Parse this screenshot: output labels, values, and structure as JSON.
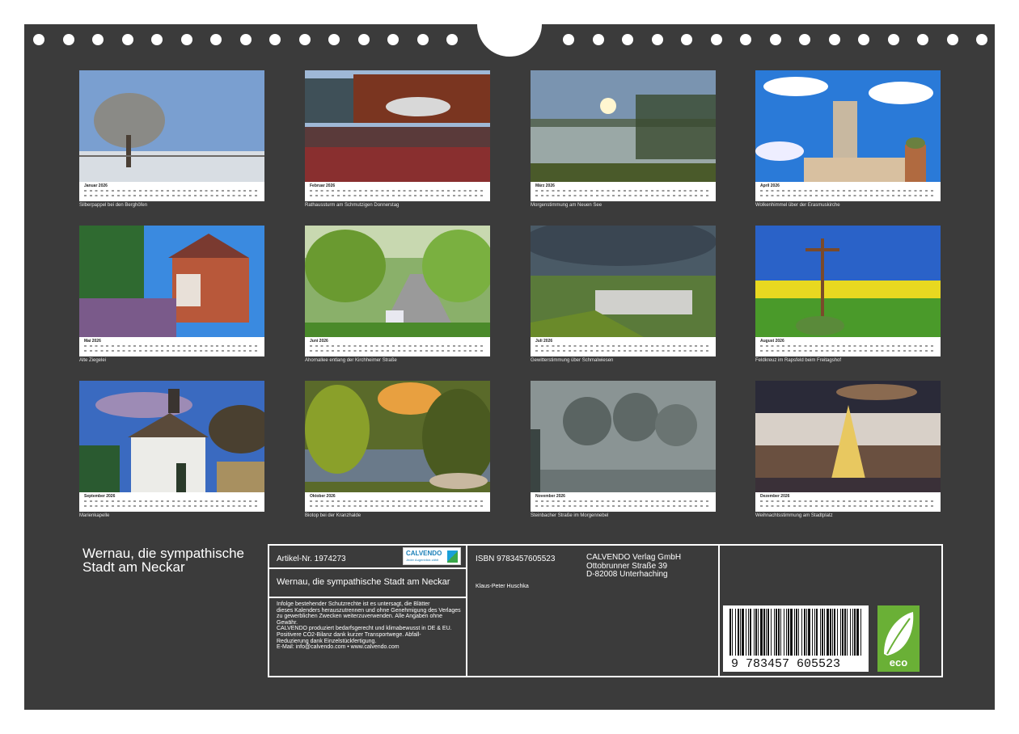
{
  "months": [
    {
      "name": "Januar 2026",
      "caption": "Silberpappel bei den Berghöfen",
      "scene": "winter-tree"
    },
    {
      "name": "Februar 2026",
      "caption": "Rathaussturm am Schmutzigen Donnerstag",
      "scene": "crowd"
    },
    {
      "name": "März 2026",
      "caption": "Morgenstimmung am Neuen See",
      "scene": "lake-sun"
    },
    {
      "name": "April 2026",
      "caption": "Wolkenhimmel über der Erasmuskirche",
      "scene": "church-tower"
    },
    {
      "name": "Mai 2026",
      "caption": "Alte Ziegelei",
      "scene": "brick-house"
    },
    {
      "name": "Juni 2026",
      "caption": "Ahornallee entlang der Kirchheimer Straße",
      "scene": "tree-avenue"
    },
    {
      "name": "Juli 2026",
      "caption": "Gewitterstimmung über Schmalwiesen",
      "scene": "storm-village"
    },
    {
      "name": "August 2026",
      "caption": "Feldkreuz im Rapsfeld beim Freitagshof",
      "scene": "rapeseed-cross"
    },
    {
      "name": "September 2026",
      "caption": "Marienkapelle",
      "scene": "chapel"
    },
    {
      "name": "Oktober 2026",
      "caption": "Biotop bei der Kranzhalde",
      "scene": "autumn-pond"
    },
    {
      "name": "November 2026",
      "caption": "Steinbacher Straße im Morgennebel",
      "scene": "fog-trees"
    },
    {
      "name": "Dezember 2026",
      "caption": "Weihnachtsstimmung am Stadtplatz",
      "scene": "christmas-square"
    }
  ],
  "info": {
    "title": "Wernau, die sympathische Stadt am Neckar",
    "article": "Artikel-Nr. 1974273",
    "subtitle": "Wernau, die sympathische Stadt am Neckar",
    "legal_lines": [
      "Infolge bestehender Schutzrechte ist es untersagt, die Blätter",
      "dieses Kalenders herauszutrennen und ohne Genehmigung des Verlages",
      "zu gewerblichen Zwecken weiterzuverwenden. Alle Angaben ohne",
      "Gewähr.",
      "CALVENDO produziert bedarfsgerecht und klimabewusst in DE & EU.",
      "Positivere CO2-Bilanz dank kurzer Transportwege. Abfall-",
      "Reduzierung dank Einzelstückfertigung.",
      "E-Mail: info@calvendo.com • www.calvendo.com"
    ],
    "isbn": "ISBN 9783457605523",
    "author": "Klaus-Peter Huschka",
    "publisher_lines": [
      "CALVENDO Verlag GmbH",
      "Ottobrunner Straße 39",
      "D-82008 Unterhaching"
    ],
    "logo_text": "CALVENDO",
    "logo_tagline": "Jeder Augenblick zählt",
    "ean_text": "9  783457  605523",
    "eco_text": "eco"
  },
  "colors": {
    "sheet": "#3b3b3b",
    "lines": "#ffffff",
    "eco_green": "#6ab036",
    "logo_blue": "#1a7fb8"
  }
}
